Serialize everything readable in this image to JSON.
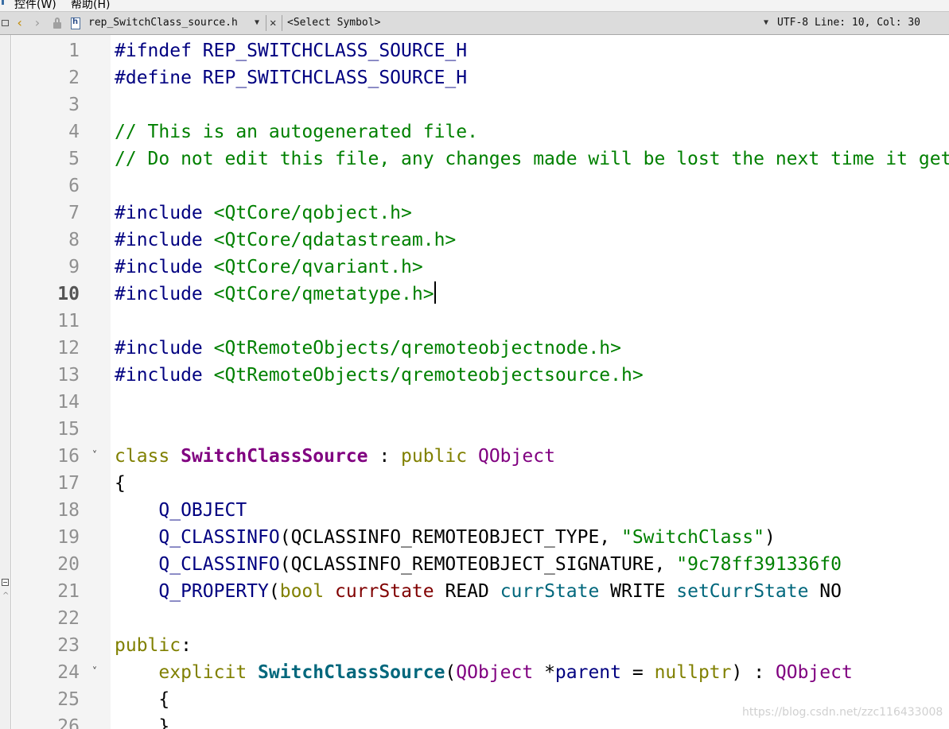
{
  "menu": {
    "items": [
      "控件(W)",
      "帮助(H)"
    ]
  },
  "toolbar": {
    "back_icon": "chevron-left-icon",
    "forward_icon": "chevron-right-icon",
    "file_name": "rep_SwitchClass_source.h",
    "symbol_placeholder": "<Select Symbol>",
    "status": "UTF-8 Line: 10, Col: 30",
    "close_glyph": "✕"
  },
  "editor": {
    "current_line": 10,
    "line_numbers": [
      "1",
      "2",
      "3",
      "4",
      "5",
      "6",
      "7",
      "8",
      "9",
      "10",
      "11",
      "12",
      "13",
      "14",
      "15",
      "16",
      "17",
      "18",
      "19",
      "20",
      "21",
      "22",
      "23",
      "24",
      "25",
      "26"
    ],
    "fold_markers": {
      "16": "˅",
      "24": "˅"
    },
    "lines": [
      [
        {
          "t": "#ifndef REP_SWITCHCLASS_SOURCE_H",
          "c": "pp"
        }
      ],
      [
        {
          "t": "#define REP_SWITCHCLASS_SOURCE_H",
          "c": "pp"
        }
      ],
      [],
      [
        {
          "t": "// This is an autogenerated file.",
          "c": "cm"
        }
      ],
      [
        {
          "t": "// Do not edit this file, any changes made will be lost the next time it gets generated.",
          "c": "cm"
        }
      ],
      [],
      [
        {
          "t": "#include ",
          "c": "pp"
        },
        {
          "t": "<QtCore/qobject.h>",
          "c": "ic"
        }
      ],
      [
        {
          "t": "#include ",
          "c": "pp"
        },
        {
          "t": "<QtCore/qdatastream.h>",
          "c": "ic"
        }
      ],
      [
        {
          "t": "#include ",
          "c": "pp"
        },
        {
          "t": "<QtCore/qvariant.h>",
          "c": "ic"
        }
      ],
      [
        {
          "t": "#include ",
          "c": "pp"
        },
        {
          "t": "<QtCore/qmetatype.h>",
          "c": "ic"
        }
      ],
      [],
      [
        {
          "t": "#include ",
          "c": "pp"
        },
        {
          "t": "<QtRemoteObjects/qremoteobjectnode.h>",
          "c": "ic"
        }
      ],
      [
        {
          "t": "#include ",
          "c": "pp"
        },
        {
          "t": "<QtRemoteObjects/qremoteobjectsource.h>",
          "c": "ic"
        }
      ],
      [],
      [],
      [
        {
          "t": "class ",
          "c": "kw"
        },
        {
          "t": "SwitchClassSource",
          "c": "cls"
        },
        {
          "t": " : ",
          "c": "df"
        },
        {
          "t": "public ",
          "c": "kw"
        },
        {
          "t": "QObject",
          "c": "type"
        }
      ],
      [
        {
          "t": "{",
          "c": "df"
        }
      ],
      [
        {
          "t": "    ",
          "c": "df"
        },
        {
          "t": "Q_OBJECT",
          "c": "mac"
        }
      ],
      [
        {
          "t": "    ",
          "c": "df"
        },
        {
          "t": "Q_CLASSINFO",
          "c": "mac"
        },
        {
          "t": "(QCLASSINFO_REMOTEOBJECT_TYPE, ",
          "c": "df"
        },
        {
          "t": "\"SwitchClass\"",
          "c": "str"
        },
        {
          "t": ")",
          "c": "df"
        }
      ],
      [
        {
          "t": "    ",
          "c": "df"
        },
        {
          "t": "Q_CLASSINFO",
          "c": "mac"
        },
        {
          "t": "(QCLASSINFO_REMOTEOBJECT_SIGNATURE, ",
          "c": "df"
        },
        {
          "t": "\"9c78ff391336f0",
          "c": "str"
        }
      ],
      [
        {
          "t": "    ",
          "c": "df"
        },
        {
          "t": "Q_PROPERTY",
          "c": "mac"
        },
        {
          "t": "(",
          "c": "df"
        },
        {
          "t": "bool ",
          "c": "kw"
        },
        {
          "t": "currState",
          "c": "fld"
        },
        {
          "t": " READ ",
          "c": "df"
        },
        {
          "t": "currState",
          "c": "fn"
        },
        {
          "t": " WRITE ",
          "c": "df"
        },
        {
          "t": "setCurrState",
          "c": "fn"
        },
        {
          "t": " NO",
          "c": "df"
        }
      ],
      [],
      [
        {
          "t": "public",
          "c": "kw"
        },
        {
          "t": ":",
          "c": "df"
        }
      ],
      [
        {
          "t": "    ",
          "c": "df"
        },
        {
          "t": "explicit ",
          "c": "kw"
        },
        {
          "t": "SwitchClassSource",
          "c": "fnb"
        },
        {
          "t": "(",
          "c": "df"
        },
        {
          "t": "QObject",
          "c": "type"
        },
        {
          "t": " *",
          "c": "df"
        },
        {
          "t": "parent",
          "c": "mac"
        },
        {
          "t": " = ",
          "c": "df"
        },
        {
          "t": "nullptr",
          "c": "kw"
        },
        {
          "t": ") : ",
          "c": "df"
        },
        {
          "t": "QObject",
          "c": "type"
        }
      ],
      [
        {
          "t": "    {",
          "c": "df"
        }
      ],
      [
        {
          "t": "    }",
          "c": "df"
        }
      ]
    ]
  },
  "watermark": "https://blog.csdn.net/zzc116433008"
}
